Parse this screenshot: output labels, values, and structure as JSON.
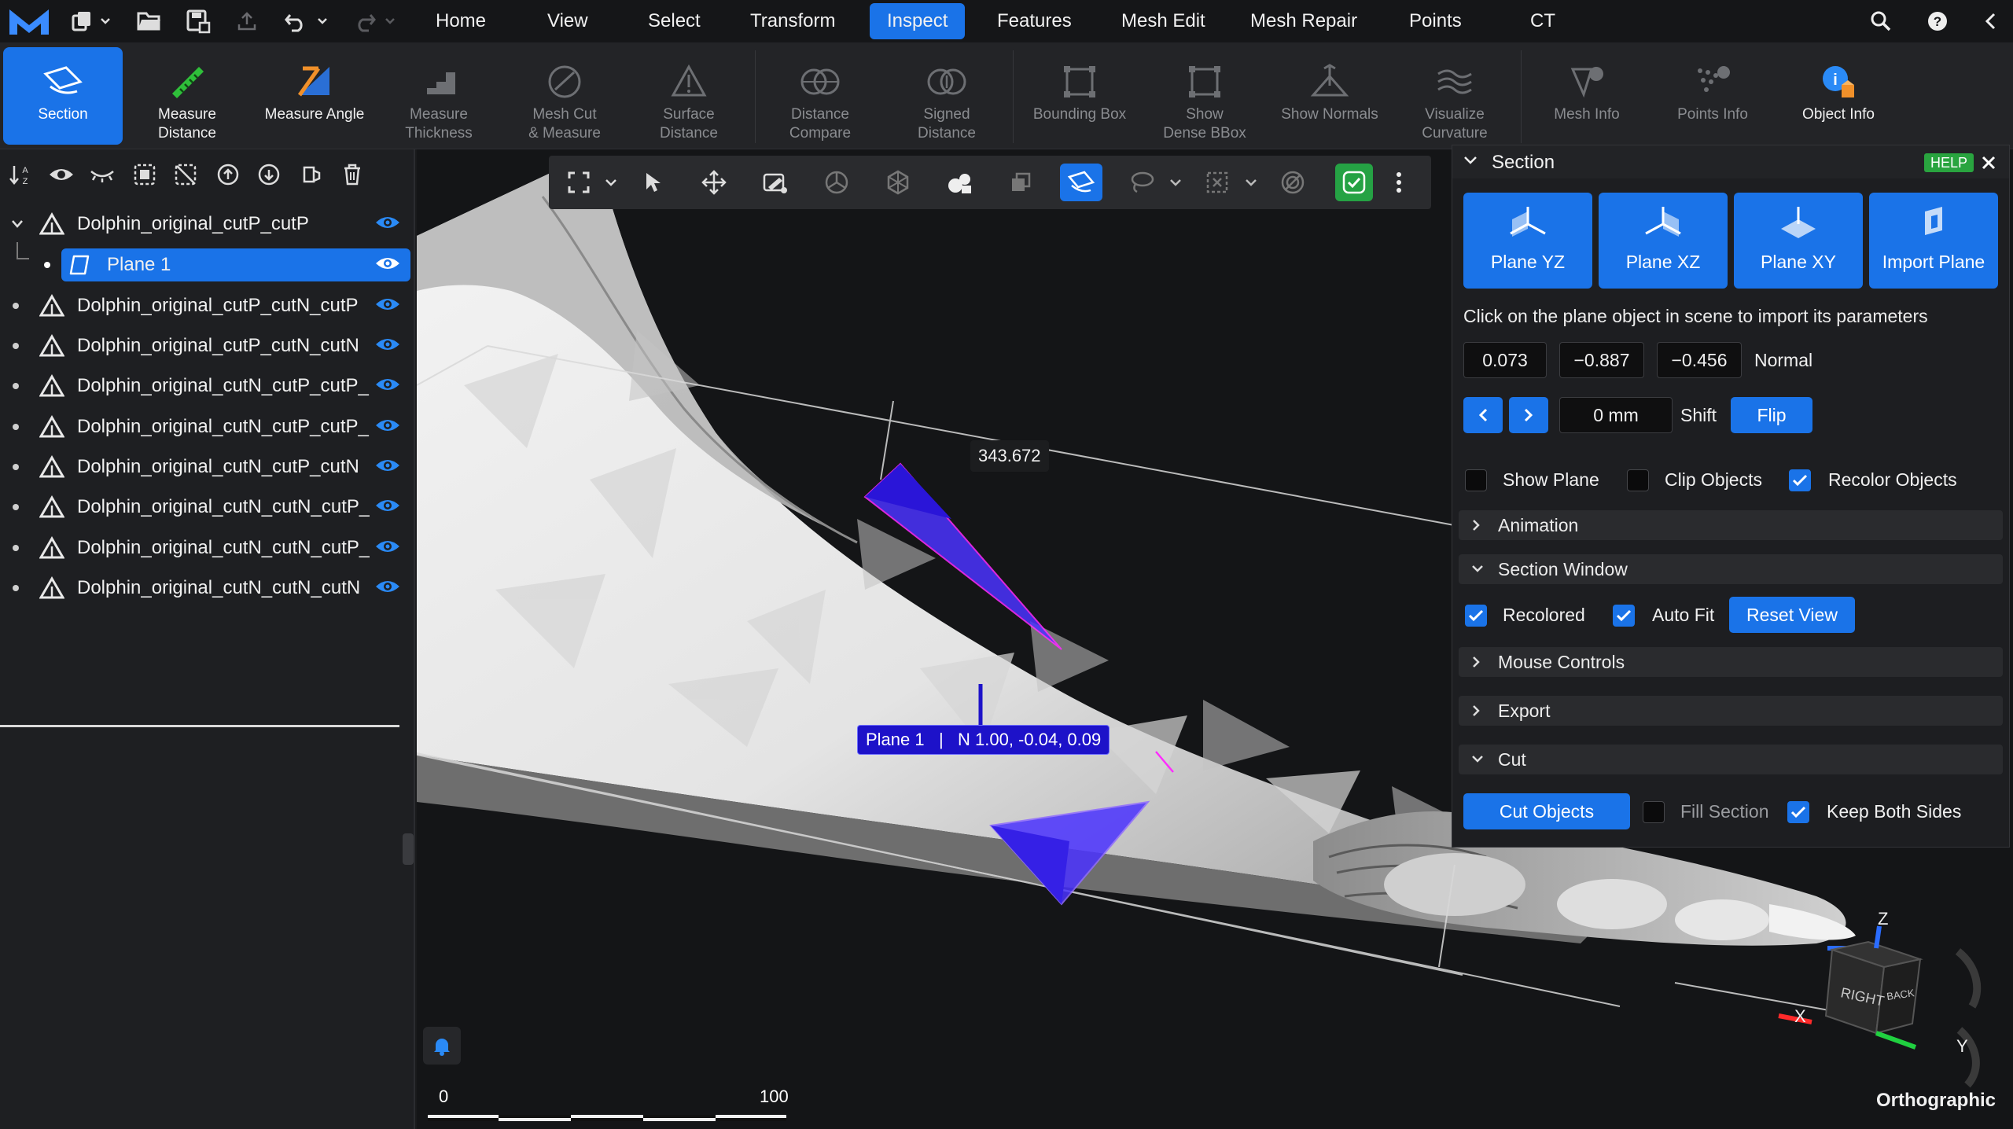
{
  "colors": {
    "accent": "#1a73e8",
    "green": "#25a244",
    "plane": "#1d12c9"
  },
  "topbar": {
    "menus": [
      "Home",
      "View",
      "Select",
      "Transform",
      "Inspect",
      "Features",
      "Mesh Edit",
      "Mesh Repair",
      "Points",
      "CT"
    ],
    "active_menu": "Inspect",
    "icons": [
      "logo-icon",
      "new-file-icon",
      "open-folder-icon",
      "save-icon",
      "export-icon",
      "undo-icon",
      "redo-icon",
      "search-icon",
      "help-icon",
      "collapse-icon"
    ]
  },
  "ribbon": {
    "tools": [
      {
        "label": "Section",
        "icon": "section-icon",
        "state": "active"
      },
      {
        "label": "Measure\nDistance",
        "icon": "ruler-icon",
        "state": "normal"
      },
      {
        "label": "Measure Angle",
        "icon": "angle-icon",
        "state": "normal"
      },
      {
        "label": "Measure\nThickness",
        "icon": "thickness-icon",
        "state": "disabled"
      },
      {
        "label": "Mesh Cut\n& Measure",
        "icon": "mesh-cut-icon",
        "state": "disabled"
      },
      {
        "label": "Surface\nDistance",
        "icon": "surface-distance-icon",
        "state": "disabled"
      },
      {
        "label": "Distance\nCompare",
        "icon": "distance-compare-icon",
        "state": "disabled"
      },
      {
        "label": "Signed\nDistance",
        "icon": "signed-distance-icon",
        "state": "disabled"
      },
      {
        "label": "Bounding Box",
        "icon": "bounding-box-icon",
        "state": "disabled"
      },
      {
        "label": "Show\nDense BBox",
        "icon": "dense-bbox-icon",
        "state": "disabled"
      },
      {
        "label": "Show Normals",
        "icon": "normals-icon",
        "state": "disabled"
      },
      {
        "label": "Visualize\nCurvature",
        "icon": "curvature-icon",
        "state": "disabled"
      },
      {
        "label": "Mesh Info",
        "icon": "mesh-info-icon",
        "state": "disabled"
      },
      {
        "label": "Points Info",
        "icon": "points-info-icon",
        "state": "disabled"
      },
      {
        "label": "Object Info",
        "icon": "object-info-icon",
        "state": "normal"
      }
    ]
  },
  "scene_tree": {
    "toolbar_icons": [
      "sort-icon",
      "show-all-icon",
      "hide-all-icon",
      "select-all-icon",
      "deselect-icon",
      "move-up-icon",
      "move-down-icon",
      "group-icon",
      "delete-icon"
    ],
    "root": "Dolphin_original_cutP_cutP",
    "selected_child": "Plane 1",
    "items": [
      "Dolphin_original_cutP_cutN_cutP",
      "Dolphin_original_cutP_cutN_cutN",
      "Dolphin_original_cutN_cutP_cutP_",
      "Dolphin_original_cutN_cutP_cutP_",
      "Dolphin_original_cutN_cutP_cutN",
      "Dolphin_original_cutN_cutN_cutP_",
      "Dolphin_original_cutN_cutN_cutP_",
      "Dolphin_original_cutN_cutN_cutN"
    ]
  },
  "viewport": {
    "toolbar_icons": [
      "fit-view-icon",
      "pointer-icon",
      "move-icon",
      "paint-select-icon",
      "orbit-icon",
      "transform-icon",
      "camera-icon",
      "duplicate-icon",
      "section-view-icon",
      "lasso-icon",
      "box-select-icon",
      "disable-icon",
      "check-icon",
      "more-icon"
    ],
    "distance_label": "343.672",
    "plane_label": "Plane 1   |   N 1.00, -0.04, 0.09",
    "scale": {
      "min": "0",
      "max": "100"
    },
    "projection": "Orthographic",
    "axes": {
      "x": "X",
      "y": "Y",
      "z": "Z"
    },
    "cube_faces": {
      "right": "RIGHT",
      "back": "BACK"
    }
  },
  "section_panel": {
    "title": "Section",
    "help": "HELP",
    "plane_buttons": [
      "Plane YZ",
      "Plane XZ",
      "Plane XY",
      "Import Plane"
    ],
    "hint": "Click on the plane object in scene to import its parameters",
    "normal": {
      "x": "0.073",
      "y": "−0.887",
      "z": "−0.456",
      "label": "Normal"
    },
    "shift": {
      "value": "0 mm",
      "label": "Shift",
      "flip": "Flip"
    },
    "checks1": [
      {
        "label": "Show Plane",
        "checked": false
      },
      {
        "label": "Clip Objects",
        "checked": false
      },
      {
        "label": "Recolor Objects",
        "checked": true
      }
    ],
    "groups": {
      "animation": "Animation",
      "section_window": "Section Window",
      "mouse_controls": "Mouse Controls",
      "export": "Export",
      "cut": "Cut"
    },
    "section_window": {
      "recolored": "Recolored",
      "auto_fit": "Auto Fit",
      "reset_view": "Reset View"
    },
    "cut": {
      "cut_objects": "Cut Objects",
      "fill_section": "Fill Section",
      "keep_both": "Keep Both Sides"
    }
  }
}
